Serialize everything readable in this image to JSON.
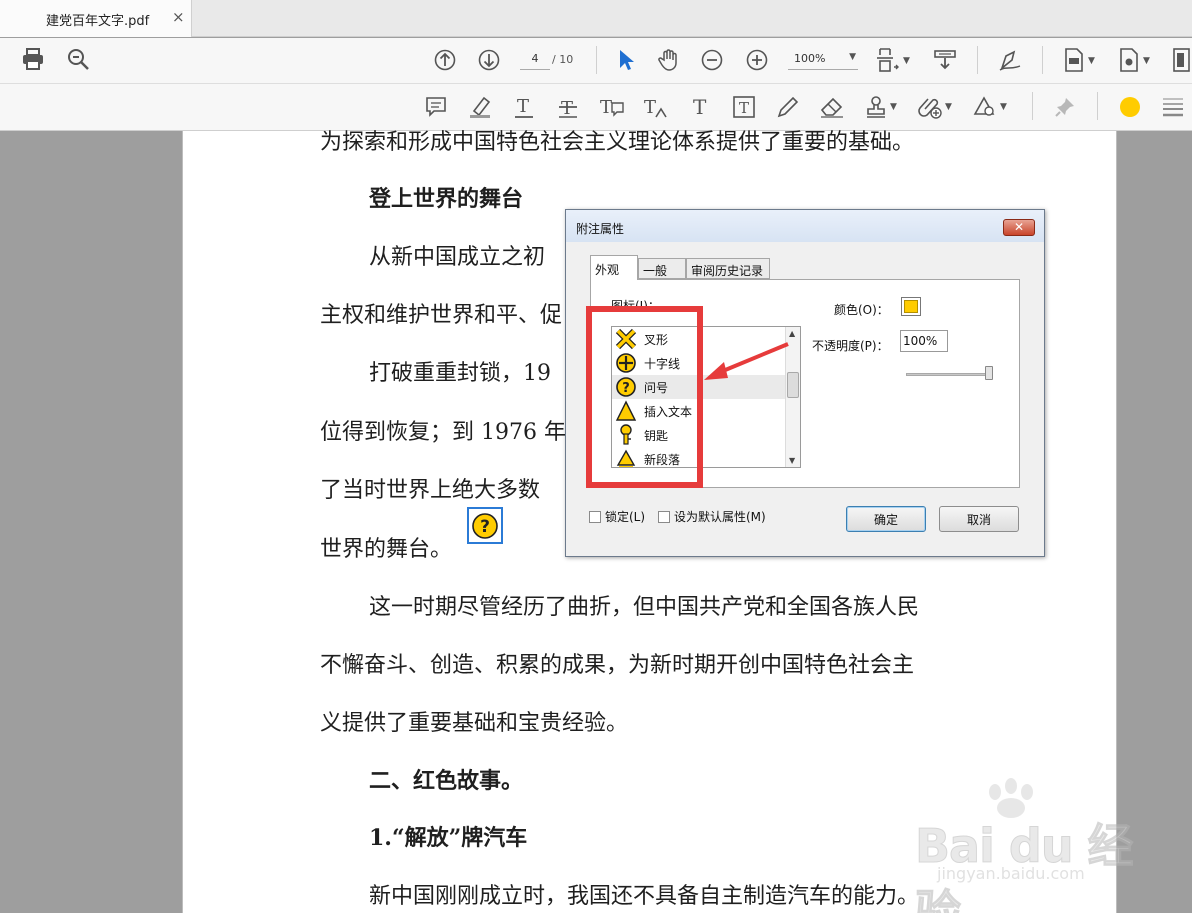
{
  "tab": {
    "title": "建党百年文字.pdf",
    "close": "×"
  },
  "toolbar": {
    "page_current": "4",
    "page_total": "/ 10",
    "zoom": "100%"
  },
  "document": {
    "lines": [
      "为探索和形成中国特色社会主义理论体系提供了重要的基础。",
      "登上世界的舞台",
      "从新中国成立之初",
      "主权和维护世界和平、促",
      "打破重重封锁，19",
      "位得到恢复；到 1976 年",
      "了当时世界上绝大多数",
      "世界的舞台。",
      "这一时期尽管经历了曲折，但中国共产党和全国各族人民",
      "不懈奋斗、创造、积累的成果，为新时期开创中国特色社会主",
      "义提供了重要基础和宝贵经验。",
      "二、红色故事。",
      "1.“解放”牌汽车",
      "新中国刚刚成立时，我国还不具备自主制造汽车的能力。"
    ]
  },
  "dialog": {
    "title": "附注属性",
    "close": "✕",
    "tabs": [
      "外观",
      "一般",
      "审阅历史记录"
    ],
    "icon_label": "图标(I)：",
    "icons": [
      "叉形",
      "十字线",
      "问号",
      "插入文本",
      "钥匙",
      "新段落"
    ],
    "color_label": "颜色(O)：",
    "color_value": "#FFCC00",
    "opacity_label": "不透明度(P)：",
    "opacity_value": "100%",
    "lock_label": "锁定(L)",
    "default_label": "设为默认属性(M)",
    "ok": "确定",
    "cancel": "取消"
  },
  "watermark": {
    "logo": "Bai du 经验",
    "url": "jingyan.baidu.com"
  }
}
